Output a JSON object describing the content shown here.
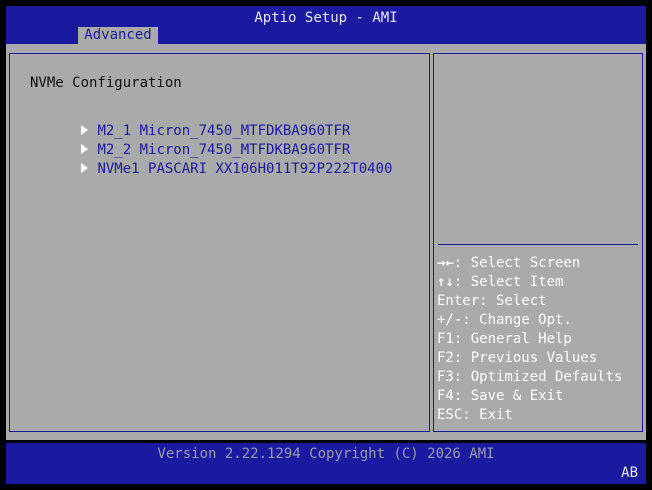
{
  "header": {
    "title": "Aptio Setup - AMI",
    "active_tab": "Advanced"
  },
  "main": {
    "section_title": "NVMe Configuration",
    "items": [
      {
        "label": "M2_1 Micron_7450_MTFDKBA960TFR"
      },
      {
        "label": "M2_2 Micron_7450_MTFDKBA960TFR"
      },
      {
        "label": "NVMe1 PASCARI XX106H011T92P222T0400"
      }
    ]
  },
  "help": {
    "select_screen": {
      "key": "→←",
      "text": ": Select Screen"
    },
    "select_item": {
      "key": "↑↓",
      "text": ": Select Item"
    },
    "lines": [
      "Enter: Select",
      "+/-: Change Opt.",
      "F1: General Help",
      "F2: Previous Values",
      "F3: Optimized Defaults",
      "F4: Save & Exit",
      "ESC: Exit"
    ]
  },
  "footer": {
    "version": "Version 2.22.1294 Copyright (C) 2026 AMI",
    "corner": "AB"
  },
  "colors": {
    "bios_blue": "#1a1aa0",
    "panel_gray": "#aaaaaa",
    "text_white": "#ffffff"
  }
}
